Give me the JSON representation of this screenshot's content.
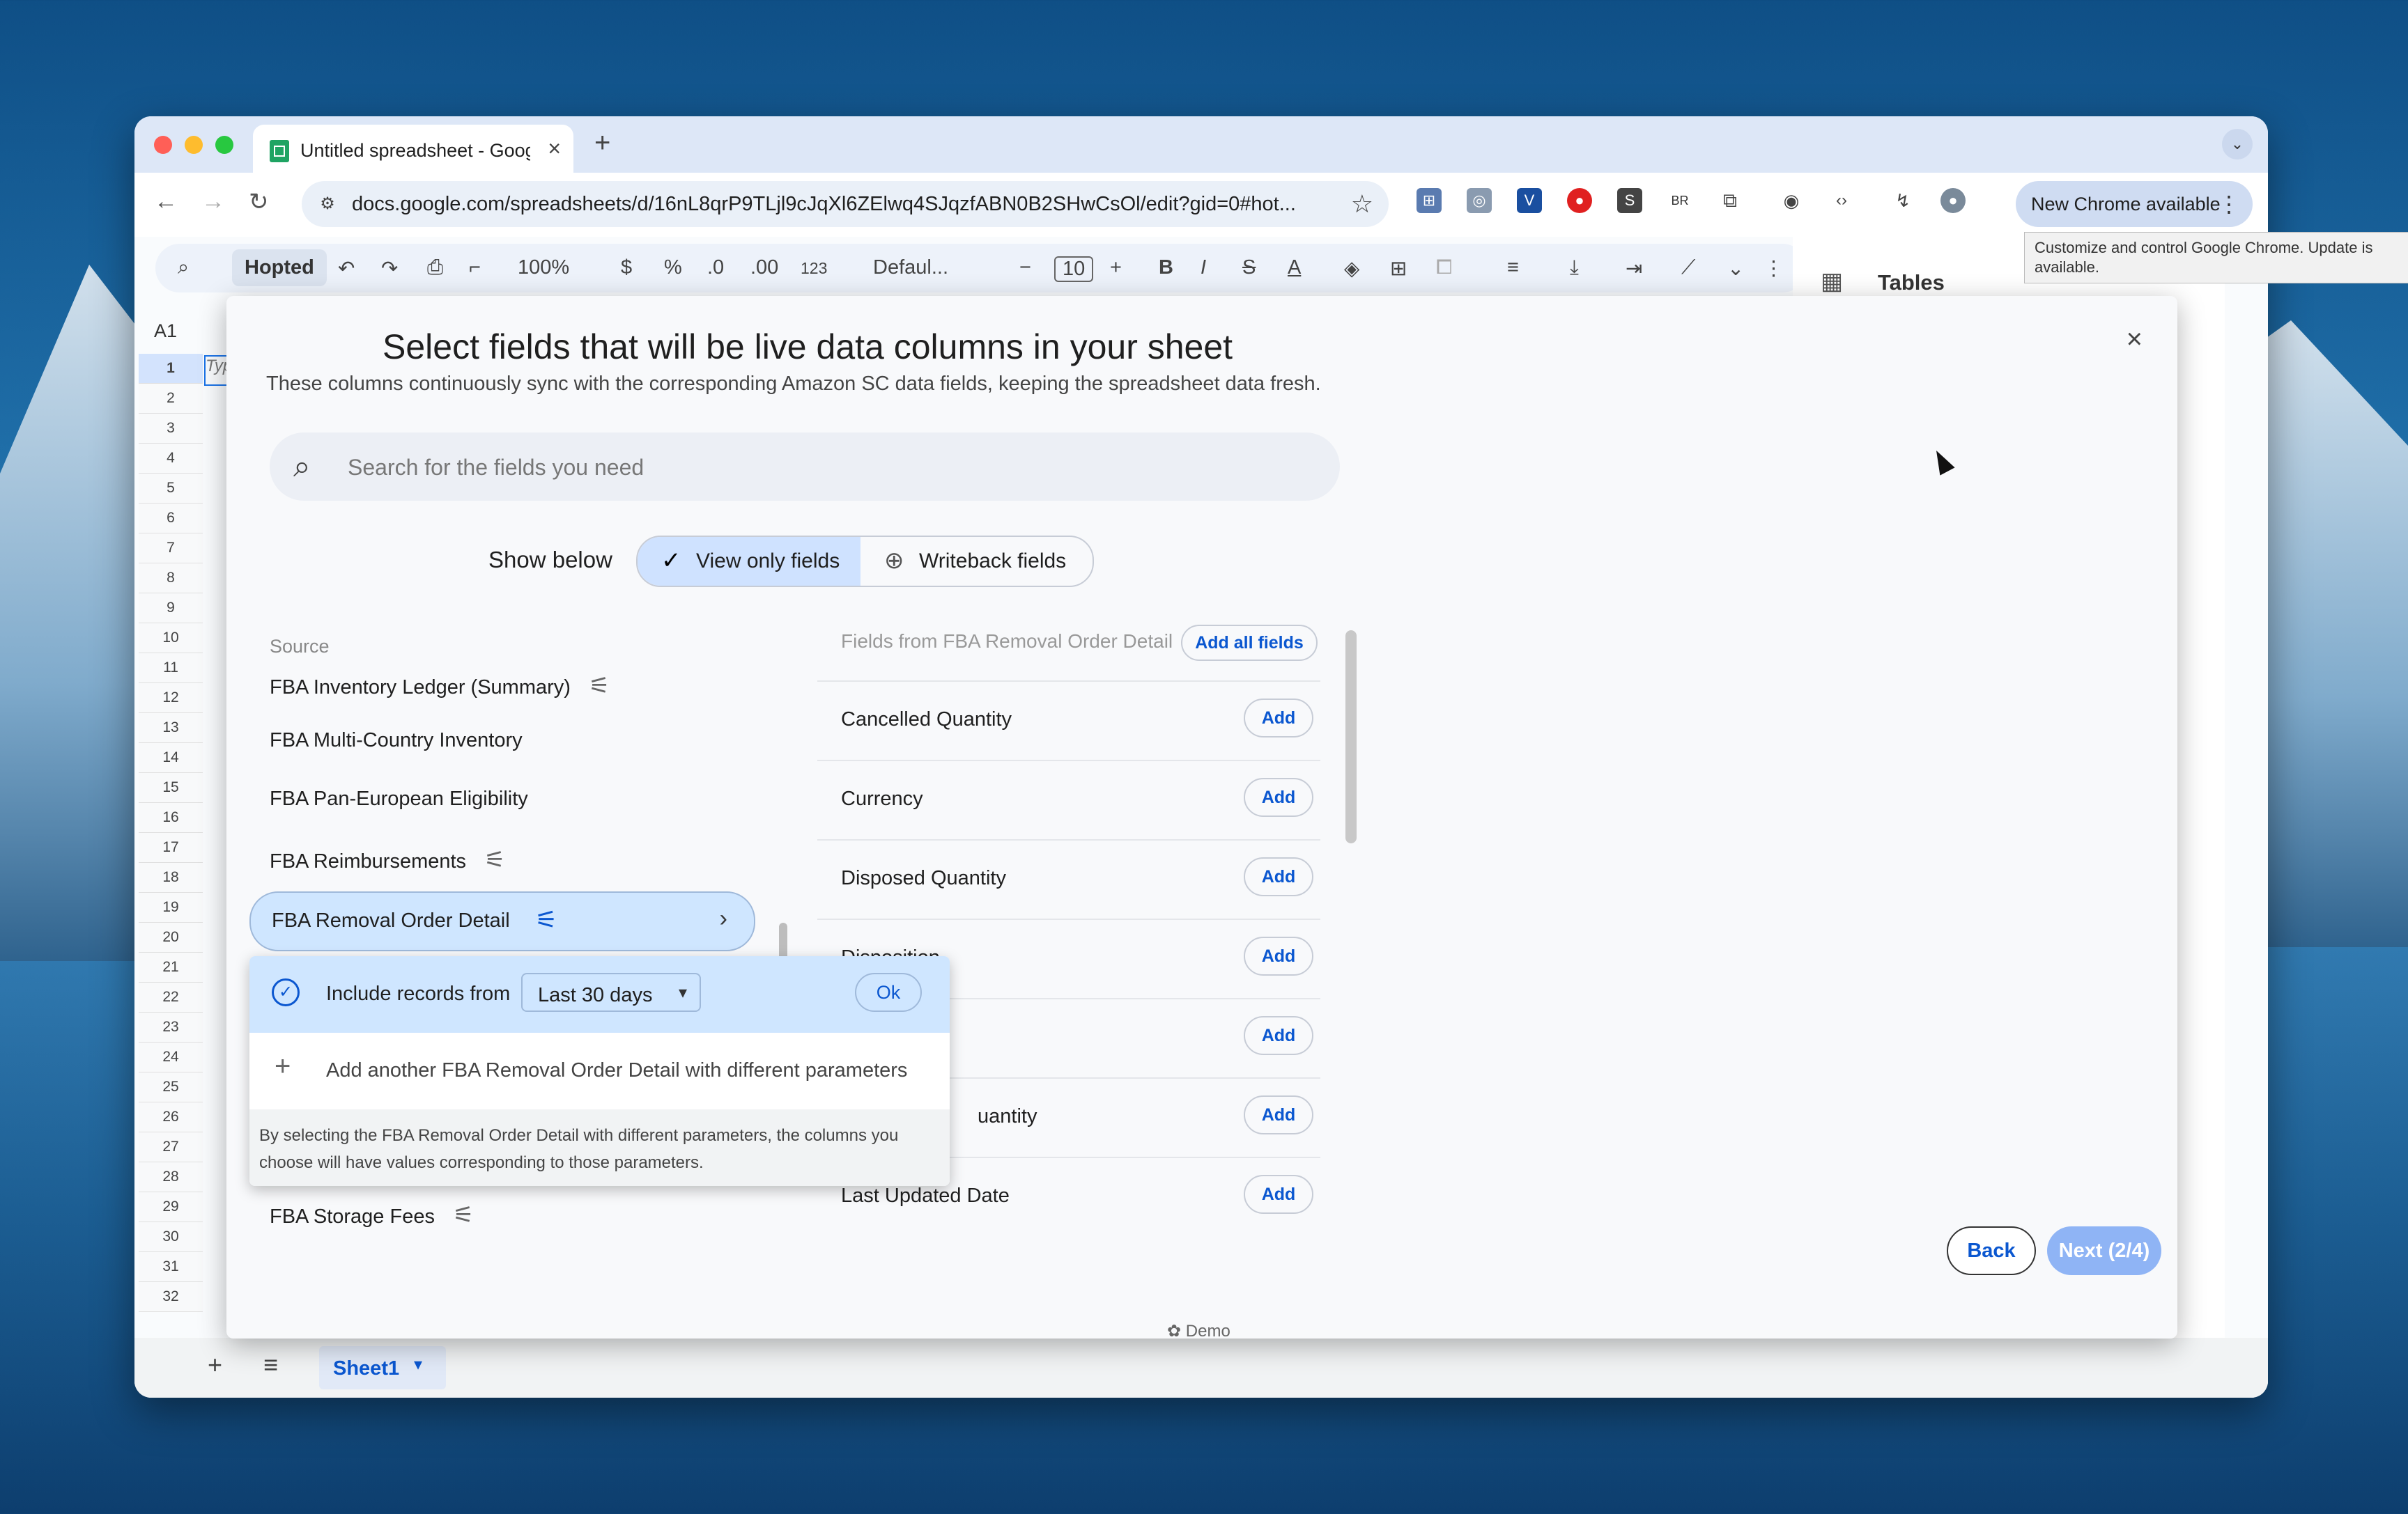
{
  "browser": {
    "tab_title": "Untitled spreadsheet - Google Sheets",
    "url": "docs.google.com/spreadsheets/d/16nL8qrP9TLjl9cJqXl6ZElwq4SJqzfABN0B2SHwCsOl/edit?gid=0#hot...",
    "new_chrome_label": "New Chrome available",
    "tooltip": "Customize and control Google Chrome. Update is available.",
    "ext_br": "BR",
    "ext_s": "S"
  },
  "sheets": {
    "hopted": "Hopted",
    "zoom": "100%",
    "currency": "$",
    "percent": "%",
    "dec_dec": ".0",
    "dec_inc": ".00",
    "number_format": "123",
    "font": "Defaul...",
    "font_size": "10",
    "cell_ref": "A1",
    "rows": [
      "1",
      "2",
      "3",
      "4",
      "5",
      "6",
      "7",
      "8",
      "9",
      "10",
      "11",
      "12",
      "13",
      "14",
      "15",
      "16",
      "17",
      "18",
      "19",
      "20",
      "21",
      "22",
      "23",
      "24",
      "25",
      "26",
      "27",
      "28",
      "29",
      "30",
      "31",
      "32"
    ],
    "cell_a1": "Typ",
    "tables_panel_title": "Tables",
    "sheet_tab": "Sheet1"
  },
  "modal": {
    "title": "Select fields that will be live data columns in your sheet",
    "subtitle": "These columns continuously sync with the corresponding Amazon SC data fields, keeping the spreadsheet data fresh.",
    "search_placeholder": "Search for the fields you need",
    "show_below_label": "Show below",
    "view_only_label": "View only fields",
    "writeback_label": "Writeback fields",
    "source_label": "Source",
    "sources": [
      "FBA Inventory Ledger (Summary)",
      "FBA Multi-Country Inventory",
      "FBA Pan-European Eligibility",
      "FBA Reimbursements",
      "FBA Removal Order Detail",
      "FBA Storage Fees"
    ],
    "popup": {
      "include_label": "Include records from",
      "range_value": "Last 30 days",
      "ok_label": "Ok",
      "add_another": "Add another FBA Removal Order Detail with different parameters",
      "note": "By selecting the FBA Removal Order Detail with different parameters, the columns you choose will have values corresponding to those parameters."
    },
    "fields_header": "Fields from FBA Removal Order Detail",
    "add_all_label": "Add all fields",
    "add_label": "Add",
    "fields": [
      "Cancelled Quantity",
      "Currency",
      "Disposed Quantity",
      "Disposition",
      "",
      "uantity",
      "Last Updated Date"
    ],
    "back_label": "Back",
    "next_label": "Next (2/4)",
    "demo_label": "Demo"
  }
}
